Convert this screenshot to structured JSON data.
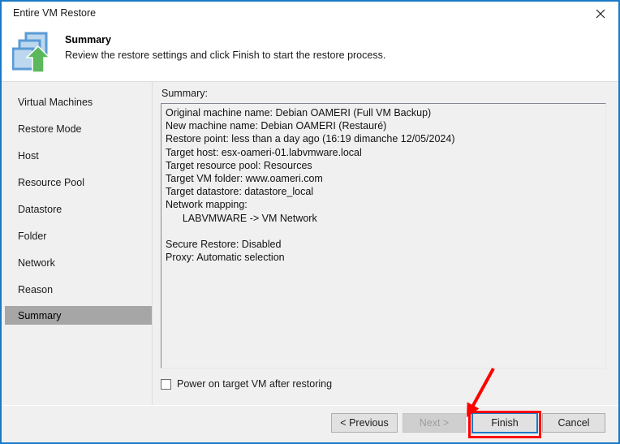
{
  "window": {
    "title": "Entire VM Restore",
    "close_icon": "close-icon"
  },
  "header": {
    "icon": "vm-restore-icon",
    "title": "Summary",
    "subtitle": "Review the restore settings and click Finish to start the restore process."
  },
  "sidebar": {
    "items": [
      {
        "label": "Virtual Machines",
        "selected": false
      },
      {
        "label": "Restore Mode",
        "selected": false
      },
      {
        "label": "Host",
        "selected": false
      },
      {
        "label": "Resource Pool",
        "selected": false
      },
      {
        "label": "Datastore",
        "selected": false
      },
      {
        "label": "Folder",
        "selected": false
      },
      {
        "label": "Network",
        "selected": false
      },
      {
        "label": "Reason",
        "selected": false
      },
      {
        "label": "Summary",
        "selected": true
      }
    ]
  },
  "content": {
    "summary_label": "Summary:",
    "summary_text": "Original machine name: Debian OAMERI (Full VM Backup)\nNew machine name: Debian OAMERI (Restauré)\nRestore point: less than a day ago (16:19 dimanche 12/05/2024)\nTarget host: esx-oameri-01.labvmware.local\nTarget resource pool: Resources\nTarget VM folder: www.oameri.com\nTarget datastore: datastore_local\nNetwork mapping:\n      LABVMWARE -> VM Network\n\nSecure Restore: Disabled\nProxy: Automatic selection",
    "summary_lines": [
      "Original machine name: Debian OAMERI (Full VM Backup)",
      "New machine name: Debian OAMERI (Restauré)",
      "Restore point: less than a day ago (16:19 dimanche 12/05/2024)",
      "Target host: esx-oameri-01.labvmware.local",
      "Target resource pool: Resources",
      "Target VM folder: www.oameri.com",
      "Target datastore: datastore_local",
      "Network mapping:",
      "      LABVMWARE -> VM Network",
      "",
      "Secure Restore: Disabled",
      "Proxy: Automatic selection"
    ],
    "power_on_checkbox": {
      "label": "Power on target VM after restoring",
      "checked": false
    }
  },
  "footer": {
    "previous_label": "< Previous",
    "next_label": "Next >",
    "finish_label": "Finish",
    "cancel_label": "Cancel"
  },
  "annotation": {
    "arrow_color": "#ff0000",
    "highlight_color": "#ff0000",
    "target": "finish-button"
  },
  "colors": {
    "window_border": "#1a7ac7",
    "body_background": "#f0f0f0",
    "selection": "#a6a6a6",
    "focus_border": "#1a7ac7",
    "icon_blue": "#5b9bd5",
    "icon_green": "#5cb85c"
  }
}
